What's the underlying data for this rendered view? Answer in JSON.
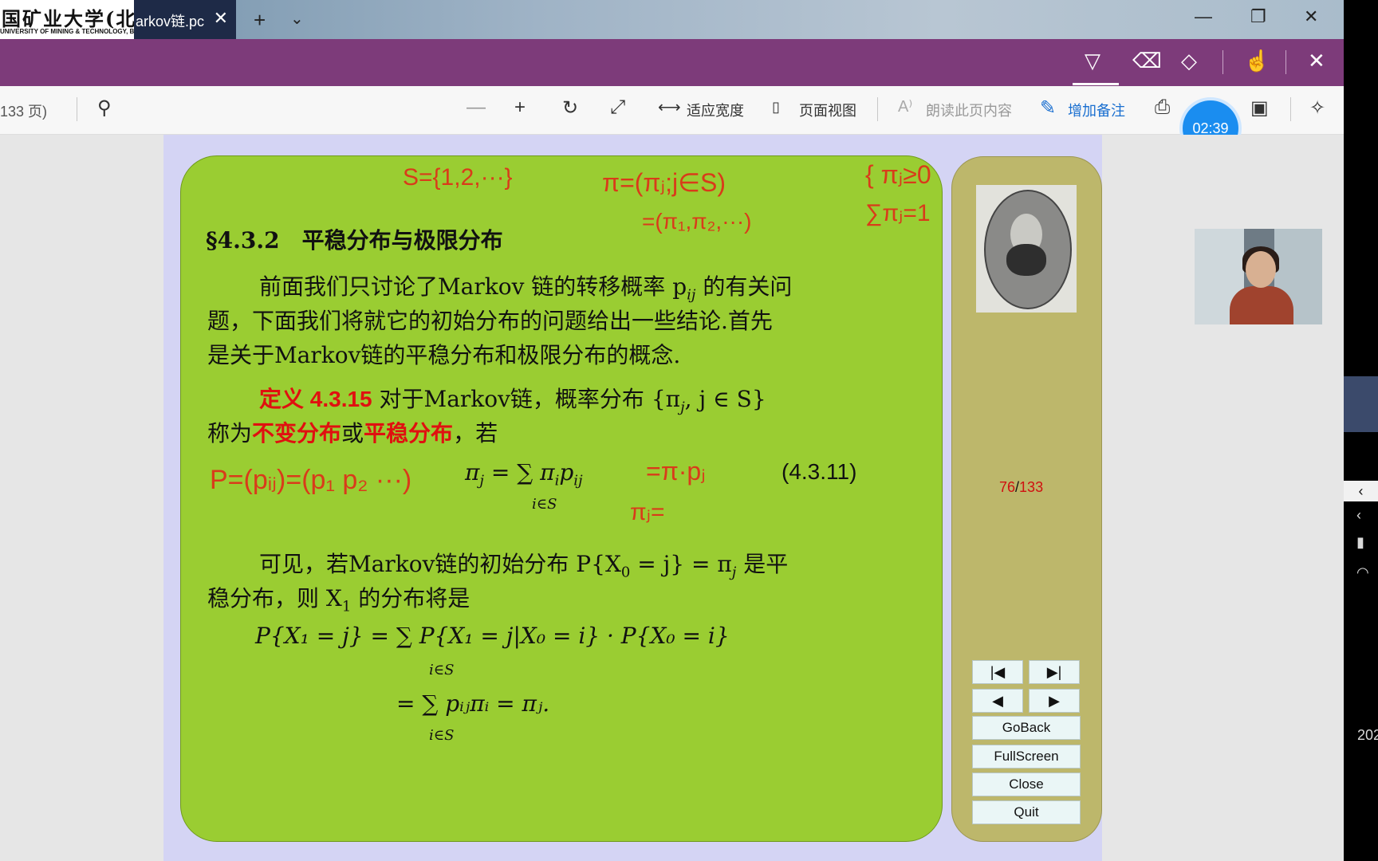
{
  "tab": {
    "logo_title": "国矿业大学(北京)",
    "logo_subtitle": "UNIVERSITY OF MINING & TECHNOLOGY, BEIJING",
    "title": "arkov链.pc"
  },
  "toolbar": {
    "page_info": "133 页)",
    "fit_width": "适应宽度",
    "page_view": "页面视图",
    "read_aloud": "朗读此页内容",
    "add_note": "增加备注"
  },
  "timer": "02:39",
  "slide": {
    "heading": "§4.3.2　平稳分布与极限分布",
    "para1": [
      "前面我们只讨论了Markov 链的转移概率 p",
      "题，下面我们将就它的初始分布的问题给出一些结论.首先",
      "是关于Markov链的平稳分布和极限分布的概念."
    ],
    "para1_sub": "ij",
    "para1_tail": " 的有关问",
    "def_label": "定义 4.3.15",
    "def_text": " 对于Markov链，概率分布 {π",
    "def_text_sub": "j",
    "def_text_tail": ", j ∈ S}",
    "def_line2_a": "称为",
    "def_line2_b": "不变分布",
    "def_line2_c": "或",
    "def_line2_d": "平稳分布",
    "def_line2_e": "，若",
    "eq1_left": "π",
    "eq1_left_sub": "j",
    "eq1_mid": "= ∑ π",
    "eq1_sum_under": "i∈S",
    "eq1_right_sub": "i",
    "eq1_right": "p",
    "eq1_right_sub2": "ij",
    "eq1_number": "(4.3.11)",
    "para2_a": "可见，若Markov链的初始分布 P{X",
    "para2_sub0": "0",
    "para2_b": " = j} = π",
    "para2_sub1": "j",
    "para2_c": " 是平",
    "para2_line2_a": "稳分布，则 X",
    "para2_line2_sub": "1",
    "para2_line2_b": " 的分布将是",
    "eq2_line1": "P{X₁ = j} = ∑ P{X₁ = j|X₀ = i} · P{X₀ = i}",
    "eq2_under1": "i∈S",
    "eq2_line2": "= ∑ pᵢⱼπᵢ = πⱼ.",
    "eq2_under2": "i∈S"
  },
  "annotations": {
    "a1": "S={1,2,···}",
    "a2": "π=(πⱼ;j∈S)",
    "a3": "=(π₁,π₂,···)",
    "a4": "{ πⱼ≥0",
    "a5": "  ∑πⱼ=1",
    "a6": "P=(pᵢⱼ)=(p₁ p₂ ···)",
    "a7": "=π·pⱼ",
    "a8": "πⱼ="
  },
  "sidebar": {
    "page_current": "76",
    "page_sep": "/",
    "page_total": "133",
    "first": "|◀",
    "last": "▶|",
    "prev": "◀",
    "next": "▶",
    "goback": "GoBack",
    "fullscreen": "FullScreen",
    "close": "Close",
    "quit": "Quit"
  },
  "right_panel": {
    "year": "202"
  }
}
